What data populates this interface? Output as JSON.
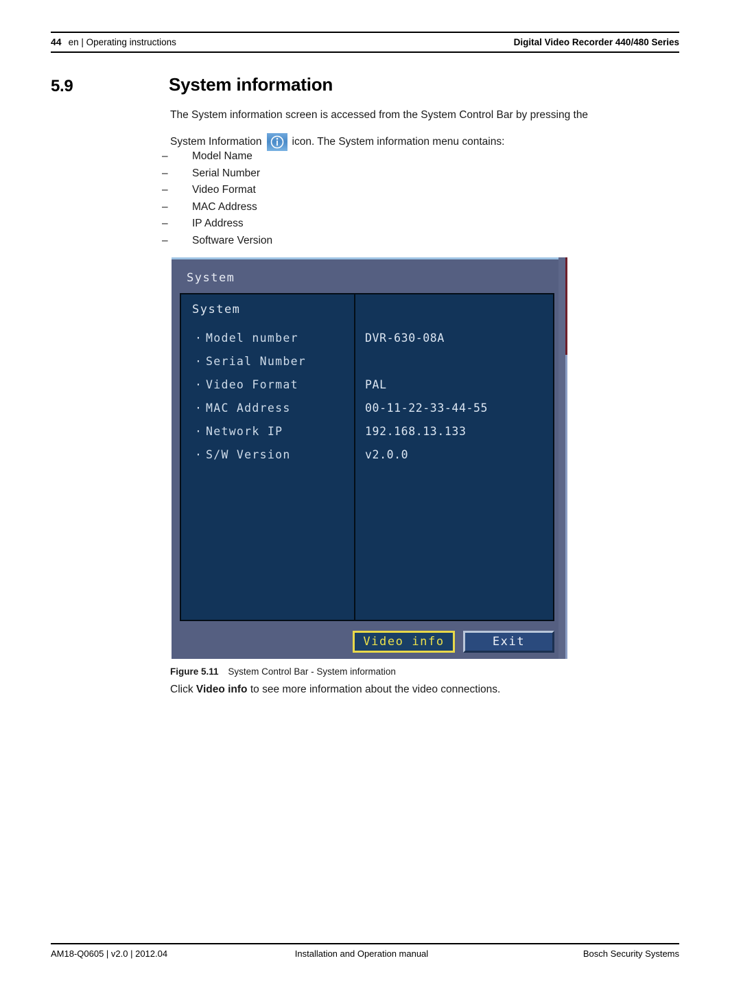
{
  "header": {
    "page_number": "44",
    "breadcrumb": "en | Operating instructions",
    "product": "Digital Video Recorder 440/480 Series"
  },
  "section": {
    "number": "5.9",
    "title": "System information",
    "paragraph_1": "The System information screen is accessed from the System Control Bar by pressing the",
    "paragraph_2_before": "System Information",
    "paragraph_2_after": "icon. The System information menu contains:",
    "icon_name": "system-information-icon",
    "bullet_dash": "–",
    "bullets": [
      {
        "label": "Model Name"
      },
      {
        "label": "Serial Number"
      },
      {
        "label": "Video Format"
      },
      {
        "label": "MAC Address"
      },
      {
        "label": "IP Address"
      },
      {
        "label": "Software Version"
      }
    ]
  },
  "dvr": {
    "window_title": "System",
    "section_label": "System",
    "rows": [
      {
        "label": "Model number",
        "value": "DVR-630-08A"
      },
      {
        "label": "Serial Number",
        "value": ""
      },
      {
        "label": "Video Format",
        "value": "PAL"
      },
      {
        "label": "MAC Address",
        "value": "00-11-22-33-44-55"
      },
      {
        "label": "Network IP",
        "value": "192.168.13.133"
      },
      {
        "label": "S/W Version",
        "value": "v2.0.0"
      }
    ],
    "buttons": {
      "video_info": "Video info",
      "exit": "Exit"
    },
    "colors": {
      "chrome": "#555f81",
      "panel": "#123459",
      "focus_border": "#e8d84a",
      "focus_text": "#ece14b",
      "button_face": "#2a4a7d"
    }
  },
  "figure": {
    "label": "Figure",
    "number": "5.11",
    "caption": "System Control Bar - System information"
  },
  "after_figure": {
    "before": "Click ",
    "bold": "Video info",
    "after": " to see more information about the video connections."
  },
  "footer": {
    "left": "AM18-Q0605 | v2.0 | 2012.04",
    "center": "Installation and Operation manual",
    "right": "Bosch Security Systems"
  }
}
